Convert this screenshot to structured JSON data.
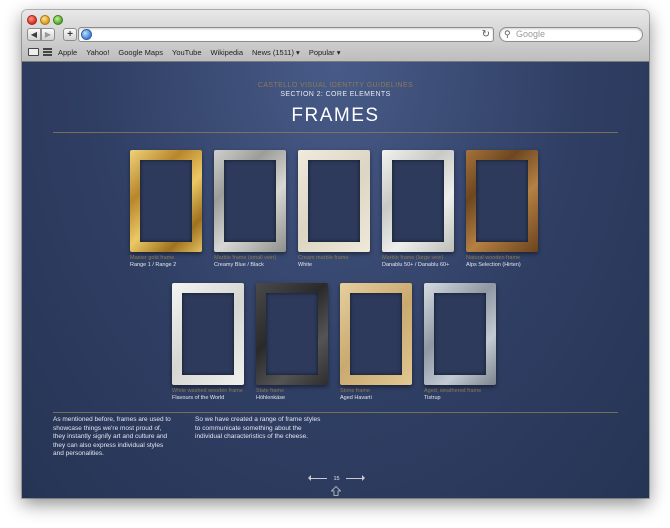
{
  "browser": {
    "nav_back": "◀",
    "nav_forward": "▶",
    "add_bookmark": "+",
    "reload_icon": "↻",
    "url_value": "",
    "search_placeholder": "Google",
    "search_icon": "⚲",
    "bookmarks": [
      "Apple",
      "Yahoo!",
      "Google Maps",
      "YouTube",
      "Wikipedia",
      "News (1511) ▾",
      "Popular ▾"
    ]
  },
  "page": {
    "subtitle_top": "CASTELLO VISUAL IDENTITY GUIDELINES",
    "subtitle_section": "SECTION 2: CORE ELEMENTS",
    "heading": "FRAMES",
    "frames_row1": [
      {
        "type": "Master gold frame",
        "name": "Range 1 / Range 2",
        "style": "gold"
      },
      {
        "type": "Marble frame (small vein)",
        "name": "Creamy Blue / Black",
        "style": "marble-grey"
      },
      {
        "type": "Cream marble frame",
        "name": "White",
        "style": "cream"
      },
      {
        "type": "Marble frame (large vein)",
        "name": "Danablu 50+ / Danablu 60+",
        "style": "marble-light"
      },
      {
        "type": "Natural wooden frame",
        "name": "Alps Selection (Hirten)",
        "style": "wood"
      }
    ],
    "frames_row2": [
      {
        "type": "White washed wooden frame",
        "name": "Flavours of the World",
        "style": "white-wood"
      },
      {
        "type": "Slate frame",
        "name": "Höhlenkäse",
        "style": "slate"
      },
      {
        "type": "Stone frame",
        "name": "Aged Havarti",
        "style": "stone"
      },
      {
        "type": "Aged, weathered frame",
        "name": "Tistrup",
        "style": "aged"
      }
    ],
    "body_left": [
      "As mentioned before, frames are used to",
      "showcase things we're most proud of,",
      "they instantly signify art and culture and",
      "they can also express individual styles",
      "and personalities."
    ],
    "body_right": [
      "So we have created a range of frame styles",
      "to communicate something about the",
      "individual characteristics of the cheese."
    ],
    "page_number": "15"
  }
}
